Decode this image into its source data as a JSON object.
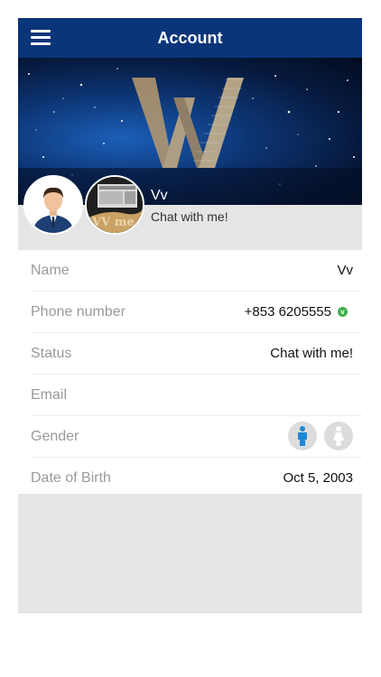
{
  "header": {
    "title": "Account",
    "bar_color": "#0b3579"
  },
  "profile": {
    "name": "Vv",
    "status": "Chat with me!",
    "avatar_icon": "user-avatar-icon",
    "photo_text": "VV me"
  },
  "fields": {
    "name": {
      "label": "Name",
      "value": "Vv"
    },
    "phone": {
      "label": "Phone number",
      "value": "+853 6205555",
      "verified_mark": "v",
      "verified_color": "#3fae49"
    },
    "status": {
      "label": "Status",
      "value": "Chat with me!"
    },
    "email": {
      "label": "Email",
      "value": ""
    },
    "gender": {
      "label": "Gender",
      "male_icon": "male-icon",
      "female_icon": "female-icon",
      "male_color": "#1e88d6",
      "female_color": "#ffffff"
    },
    "dob": {
      "label": "Date of Birth",
      "value": "Oct 5, 2003"
    }
  }
}
